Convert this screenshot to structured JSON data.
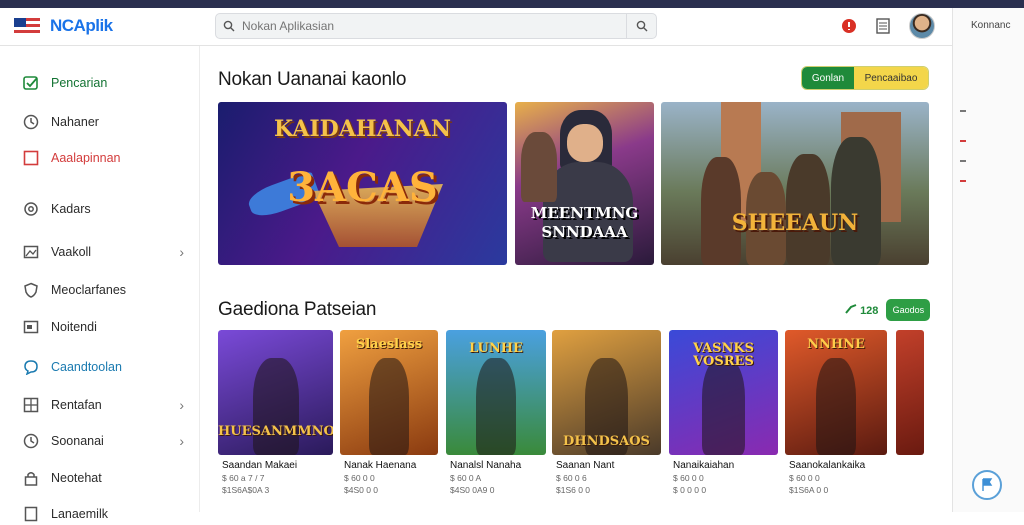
{
  "header": {
    "brand": "NCAplik",
    "search_placeholder": "Nokan Aplikasian",
    "right_panel_label": "Konnanc"
  },
  "sidebar": {
    "items": [
      {
        "label": "Pencarian",
        "icon": "check-box-icon",
        "chevron": false
      },
      {
        "label": "Nahaner",
        "icon": "clock-icon",
        "chevron": false
      },
      {
        "label": "Aaalapinnan",
        "icon": "square-icon",
        "chevron": false
      },
      {
        "label": "Kadars",
        "icon": "gear-icon",
        "chevron": false
      },
      {
        "label": "Vaakoll",
        "icon": "image-icon",
        "chevron": true
      },
      {
        "label": "Meoclarfanes",
        "icon": "shield-icon",
        "chevron": false
      },
      {
        "label": "Noitendi",
        "icon": "window-icon",
        "chevron": false
      },
      {
        "label": "Caandtoolan",
        "icon": "chat-bubble-icon",
        "chevron": false
      },
      {
        "label": "Rentafan",
        "icon": "grid-icon",
        "chevron": true
      },
      {
        "label": "Soonanai",
        "icon": "clock-icon",
        "chevron": true
      },
      {
        "label": "Neotehat",
        "icon": "lock-icon",
        "chevron": false
      },
      {
        "label": "Lanaemilk",
        "icon": "book-icon",
        "chevron": false
      }
    ]
  },
  "main": {
    "featured_title": "Nokan Uananai kaonlo",
    "toggle": {
      "left": "Gonlan",
      "right": "Pencaaibao"
    },
    "banners": [
      {
        "text_line1": "KAIDAHANAN",
        "text_line2": "3ACAS"
      },
      {
        "text_line1": "MEENTMNG",
        "text_line2": "SNNDAAA"
      },
      {
        "text_line1": "SHEEAUN",
        "text_line2": ""
      }
    ],
    "popular_title": "Gaediona Patseian",
    "popular_count": "128",
    "popular_button": "Gaodos",
    "cards": [
      {
        "art_text": "HUESANMMNOS",
        "title": "Saandan Makaei",
        "meta": "$ 60 a 7 / 7",
        "meta2": "$1S6A$0A 3"
      },
      {
        "art_text": "Slaeslass",
        "title": "Nanak Haenana",
        "meta": "$ 60 0 0",
        "meta2": "$4S0 0 0"
      },
      {
        "art_text": "LUNHE",
        "title": "Nanalsl Nanaha",
        "meta": "$ 60 0 A",
        "meta2": "$4S0 0A9 0"
      },
      {
        "art_text": "DHNDSAOS",
        "title": "Saanan Nant",
        "meta": "$ 60 0 6",
        "meta2": "$1S6 0 0"
      },
      {
        "art_text": "VASNKS VOSRES",
        "title": "Nanaikaiahan",
        "meta": "$ 60 0 0",
        "meta2": "$ 0 0 0 0"
      },
      {
        "art_text": "NNHNE",
        "title": "Saanokalankaika",
        "meta": "$ 60 0 0",
        "meta2": "$1S6A 0 0"
      }
    ]
  },
  "colors": {
    "accent_green": "#1f8a3a",
    "accent_yellow": "#f3d64a",
    "red_item": "#d33c3c",
    "blue_item": "#1a7ab0"
  }
}
